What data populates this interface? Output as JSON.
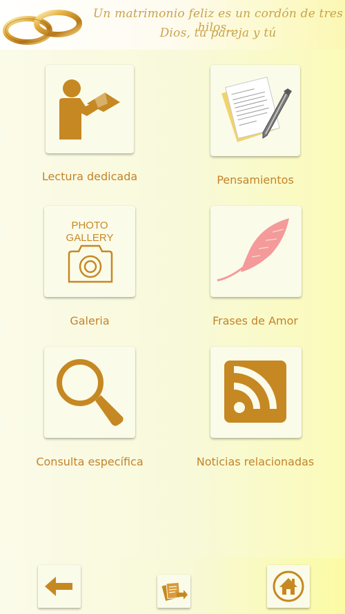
{
  "header": {
    "tagline_line1": "Un matrimonio feliz es un cordón de tres hilos...",
    "tagline_line2": "Dios, tu pareja y tú"
  },
  "menu": [
    {
      "label": "Lectura dedicada",
      "icon": "reading-person-icon"
    },
    {
      "label": "Pensamientos",
      "icon": "notepad-pen-icon"
    },
    {
      "label": "Galeria",
      "icon": "photo-gallery-icon",
      "icon_text_1": "PHOTO",
      "icon_text_2": "GALLERY"
    },
    {
      "label": "Frases de Amor",
      "icon": "feather-icon"
    },
    {
      "label": "Consulta específica",
      "icon": "magnifier-icon"
    },
    {
      "label": "Noticias relacionadas",
      "icon": "rss-icon"
    }
  ],
  "footer": {
    "back_icon": "back-arrow-icon",
    "middle_icon": "cards-share-icon",
    "home_icon": "home-icon"
  },
  "colors": {
    "accent": "#c4832a",
    "icon_brown": "#c68822",
    "feather_pink": "#f49a9a",
    "tagline_gold": "#c9a34a"
  }
}
